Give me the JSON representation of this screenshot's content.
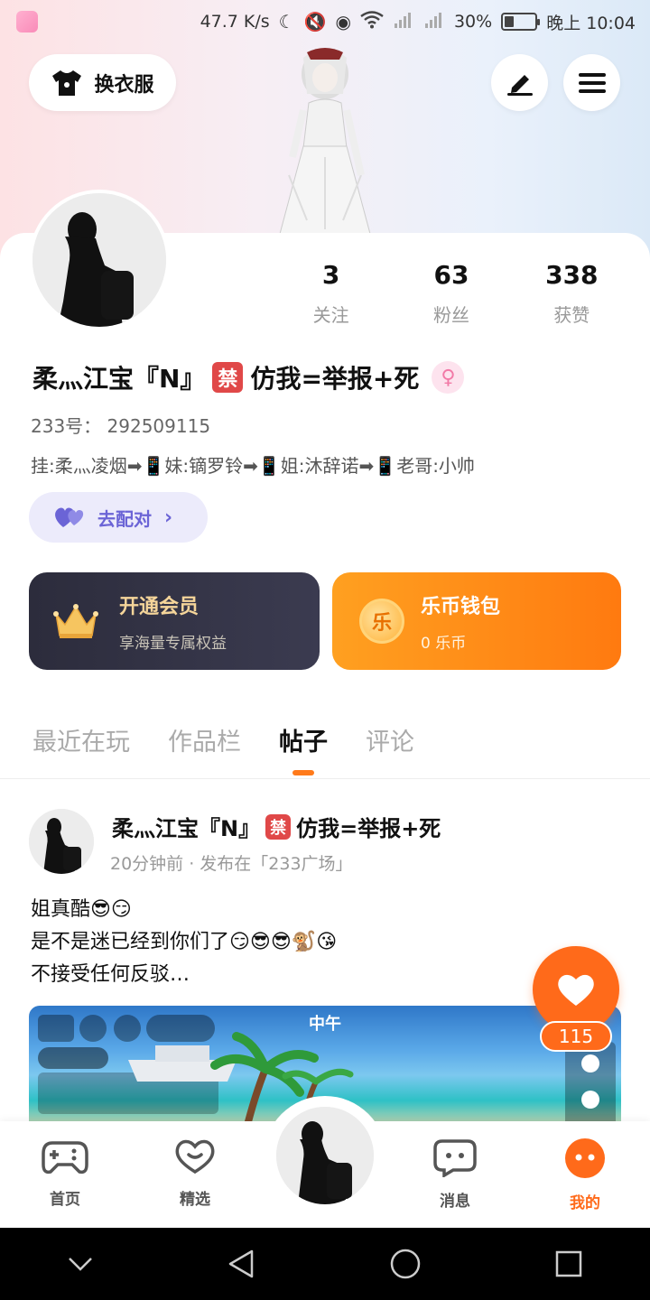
{
  "status_bar": {
    "net_speed": "47.7 K/s",
    "battery_pct": "30%",
    "battery_level": 0.3,
    "time": "晚上 10:04"
  },
  "header": {
    "outfit_label": "换衣服"
  },
  "stats": [
    {
      "num": "3",
      "label": "关注"
    },
    {
      "num": "63",
      "label": "粉丝"
    },
    {
      "num": "338",
      "label": "获赞"
    }
  ],
  "profile": {
    "name": "柔灬江宝『N』",
    "ban_badge": "禁",
    "name_suffix": "仿我=举报+死",
    "gender_symbol": "♀",
    "uid": "233号： 292509115",
    "bio": "挂:柔灬凌烟➡📱妹:镝罗铃➡📱姐:沐辞诺➡📱老哥:小帅",
    "match_label": "去配对"
  },
  "cards": {
    "vip_title": "开通会员",
    "vip_sub": "享海量专属权益",
    "wallet_title": "乐币钱包",
    "wallet_sub": "0 乐币",
    "coin_char": "乐"
  },
  "tabs": [
    {
      "label": "最近在玩"
    },
    {
      "label": "作品栏"
    },
    {
      "label": "帖子"
    },
    {
      "label": "评论"
    }
  ],
  "post": {
    "name": "柔灬江宝『N』",
    "ban_badge": "禁",
    "name_suffix": "仿我=举报+死",
    "meta": "20分钟前 · 发布在「233广场」",
    "lines": [
      "姐真酷😎😏",
      "是不是迷已经到你们了😏😎😎🐒😘",
      "不接受任何反驳…"
    ],
    "image_label": "中午",
    "like_count": "115"
  },
  "bottom_nav": [
    {
      "label": "首页"
    },
    {
      "label": "精选"
    },
    {
      "label": "消息"
    },
    {
      "label": "我的"
    }
  ],
  "colors": {
    "accent": "#ff6a1a",
    "match_text": "#6b64d6",
    "ban_red": "#e04848"
  }
}
